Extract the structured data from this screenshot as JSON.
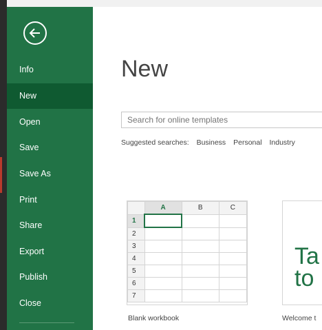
{
  "sidebar": {
    "items": [
      {
        "label": "Info"
      },
      {
        "label": "New"
      },
      {
        "label": "Open"
      },
      {
        "label": "Save"
      },
      {
        "label": "Save As"
      },
      {
        "label": "Print"
      },
      {
        "label": "Share"
      },
      {
        "label": "Export"
      },
      {
        "label": "Publish"
      },
      {
        "label": "Close"
      }
    ],
    "active_index": 1,
    "back_icon": "back-arrow-circle-icon",
    "color": "#217346",
    "active_color": "#0f5a31"
  },
  "main": {
    "title": "New",
    "search": {
      "placeholder": "Search for online templates"
    },
    "suggested": {
      "label": "Suggested searches:",
      "links": [
        "Business",
        "Personal",
        "Industry"
      ]
    },
    "templates": [
      {
        "label": "Blank workbook",
        "columns": [
          "A",
          "B",
          "C"
        ],
        "rows": [
          "1",
          "2",
          "3",
          "4",
          "5",
          "6",
          "7"
        ]
      },
      {
        "label": "Welcome t",
        "preview_lines": [
          "Ta",
          "to"
        ]
      }
    ]
  }
}
